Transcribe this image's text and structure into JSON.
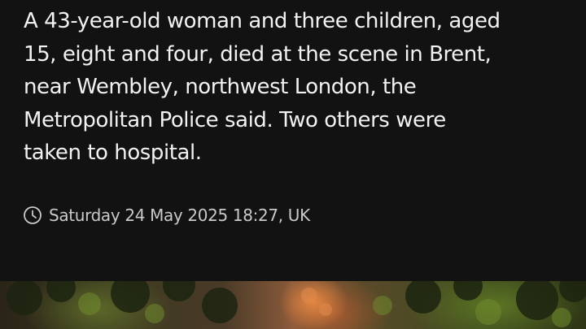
{
  "article": {
    "body": "A 43-year-old woman and three children, aged\n15, eight and four, died at the scene in Brent,\nnear Wembley, northwest London, the\nMetropolitan Police said. Two others were\ntaken to hospital.",
    "timestamp": "Saturday 24 May 2025 18:27, UK",
    "timestamp_icon": "clock-icon"
  },
  "colors": {
    "background": "#121212",
    "text": "#f2f2f2",
    "meta_text": "#c9c9c9"
  }
}
